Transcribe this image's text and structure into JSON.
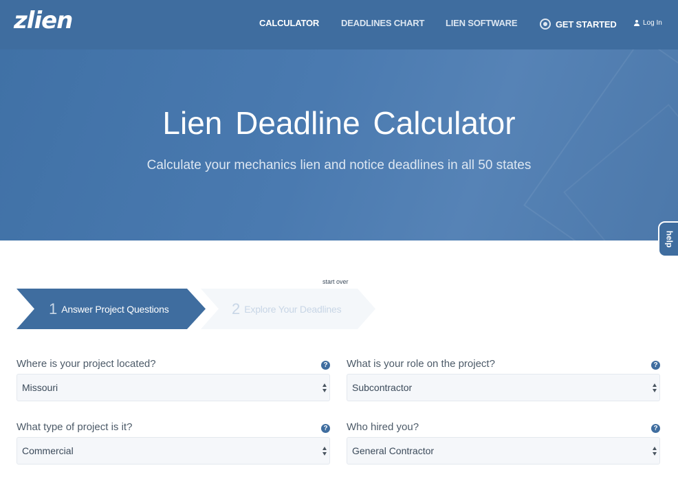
{
  "nav": {
    "logo": "zlien",
    "links": [
      {
        "label": "CALCULATOR"
      },
      {
        "label": "DEADLINES CHART"
      },
      {
        "label": "LIEN SOFTWARE"
      }
    ],
    "cta": "GET STARTED",
    "login": "Log In"
  },
  "hero": {
    "title": "Lien Deadline Calculator",
    "subtitle": "Calculate your mechanics lien and notice deadlines in all 50 states"
  },
  "help_tab": "help",
  "steps": {
    "start_over": "start over",
    "items": [
      {
        "number": "1",
        "label": "Answer Project Questions",
        "active": true
      },
      {
        "number": "2",
        "label": "Explore Your Deadlines",
        "active": false
      }
    ]
  },
  "form": {
    "questions": [
      {
        "label": "Where is your project located?",
        "value": "Missouri"
      },
      {
        "label": "What is your role on the project?",
        "value": "Subcontractor"
      },
      {
        "label": "What type of project is it?",
        "value": "Commercial"
      },
      {
        "label": "Who hired you?",
        "value": "General Contractor"
      }
    ],
    "help_glyph": "?"
  },
  "colors": {
    "brand_blue": "#3f6d9f",
    "step_inactive": "#f4f7fa",
    "select_bg": "#f5f7fa"
  },
  "icons": {
    "get_started": "target-icon",
    "login": "user-icon",
    "question": "question-circle-icon",
    "select": "chevron-up-down-icon"
  }
}
